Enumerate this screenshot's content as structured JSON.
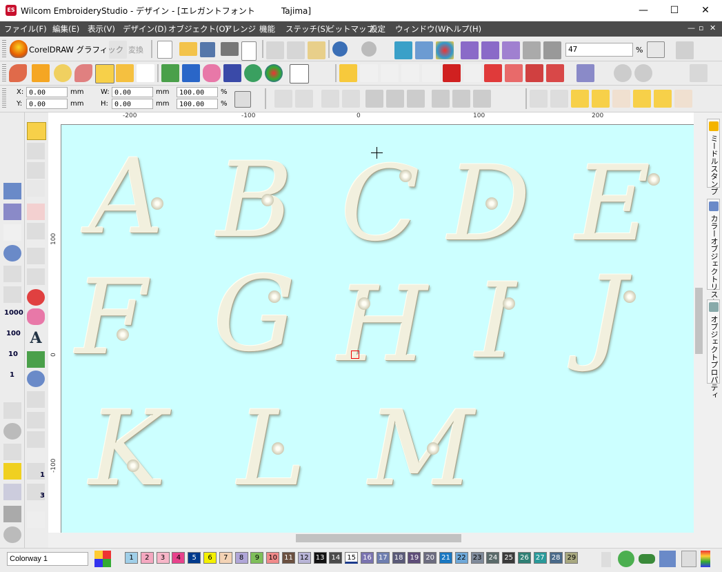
{
  "window": {
    "app_logo": "ES",
    "title": "Wilcom EmbroideryStudio - デザイン - [エレガントフォント          Tajima]",
    "minimize": "—",
    "maximize": "☐",
    "close": "✕"
  },
  "menu": {
    "items": [
      "ファイル(F)",
      "編集(E)",
      "表示(V)",
      "デザイン(D)",
      "オブジェクト(O)",
      "アレンジ",
      "機能",
      "ステッチ(S)",
      "ビットマップ",
      "設定",
      "ウィンドウ(W)",
      "ヘルプ(H)"
    ],
    "mdi_minimize": "—",
    "mdi_restore": "▫",
    "mdi_close": "✕"
  },
  "toolbar_main": {
    "coreldraw_label": "CorelDRAW グラフィック",
    "convert_label": "変換",
    "zoom_value": "47",
    "zoom_unit": "%"
  },
  "toolbar_props": {
    "x_label": "X:",
    "x_value": "0.00",
    "x_unit": "mm",
    "y_label": "Y:",
    "y_value": "0.00",
    "y_unit": "mm",
    "w_label": "W:",
    "w_value": "0.00",
    "w_unit": "mm",
    "h_label": "H:",
    "h_value": "0.00",
    "h_unit": "mm",
    "w_pct": "100.00",
    "h_pct": "100.00",
    "pct_unit": "%"
  },
  "rulers": {
    "h_labels": [
      "-200",
      "-100",
      "0",
      "100",
      "200"
    ],
    "v_labels": [
      "100",
      "0",
      "-100"
    ]
  },
  "left_tools": {
    "num_1000": "1000",
    "num_100": "100",
    "num_10": "10",
    "num_1": "1",
    "mini_1": "1",
    "mini_3": "3"
  },
  "canvas": {
    "background": "#ccffff",
    "letters": [
      "A",
      "B",
      "C",
      "D",
      "E",
      "F",
      "G",
      "H",
      "I",
      "J",
      "K",
      "L",
      "M"
    ]
  },
  "dockers": [
    {
      "label": "ミードルスタンプ",
      "icon": "needle-stamp-icon"
    },
    {
      "label": "カラーオブジェクトリスト",
      "icon": "color-object-list-icon"
    },
    {
      "label": "オブジェクトプロパティ",
      "icon": "object-properties-icon"
    }
  ],
  "bottom": {
    "colorway": "Colorway 1",
    "swatches": [
      {
        "num": "1",
        "color": "#a0cfe8"
      },
      {
        "num": "2",
        "color": "#f4a8c0"
      },
      {
        "num": "3",
        "color": "#f7b6c8"
      },
      {
        "num": "4",
        "color": "#e8428c"
      },
      {
        "num": "5",
        "color": "#003a8c"
      },
      {
        "num": "6",
        "color": "#f4f000"
      },
      {
        "num": "7",
        "color": "#f3d3b5"
      },
      {
        "num": "8",
        "color": "#b0a6d8"
      },
      {
        "num": "9",
        "color": "#7fbf5a"
      },
      {
        "num": "10",
        "color": "#f08a8a"
      },
      {
        "num": "11",
        "color": "#6b5040"
      },
      {
        "num": "12",
        "color": "#b8b4d6"
      },
      {
        "num": "13",
        "color": "#111111"
      },
      {
        "num": "14",
        "color": "#4a4a4a"
      },
      {
        "num": "15",
        "color": "#ffffff"
      },
      {
        "num": "16",
        "color": "#7b74b0"
      },
      {
        "num": "17",
        "color": "#6f7fb0"
      },
      {
        "num": "18",
        "color": "#5a5a78"
      },
      {
        "num": "19",
        "color": "#5e4d78"
      },
      {
        "num": "20",
        "color": "#6c6c80"
      },
      {
        "num": "21",
        "color": "#1a78c2"
      },
      {
        "num": "22",
        "color": "#6fa8d8"
      },
      {
        "num": "23",
        "color": "#7f8a9a"
      },
      {
        "num": "24",
        "color": "#5a6a6a"
      },
      {
        "num": "25",
        "color": "#3a3a3a"
      },
      {
        "num": "26",
        "color": "#2f7f74"
      },
      {
        "num": "27",
        "color": "#2a9a9a"
      },
      {
        "num": "28",
        "color": "#4a6a8a"
      },
      {
        "num": "29",
        "color": "#a8a880"
      }
    ]
  }
}
